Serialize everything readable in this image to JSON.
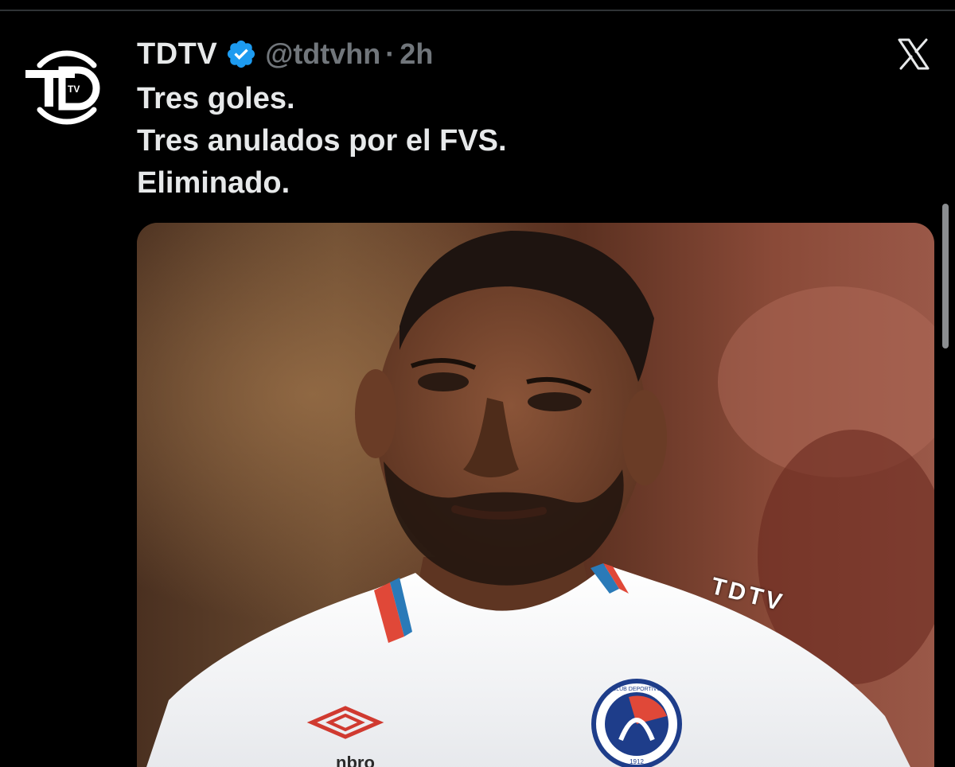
{
  "tweet": {
    "display_name": "TDTV",
    "handle": "@tdtvhn",
    "separator": "·",
    "time": "2h",
    "verified": true,
    "lines": [
      "Tres goles.",
      "Tres anulados por el FVS.",
      "Eliminado."
    ],
    "media": {
      "watermark": "TDTV",
      "kit_brand_partial": "nbro",
      "crest_text": "CLUB DEPORTIVO",
      "crest_year": "1912"
    }
  },
  "avatar": {
    "logo_text": "TV"
  },
  "icons": {
    "verified": "verified-badge-icon",
    "platform": "x-logo-icon"
  },
  "colors": {
    "background": "#000000",
    "text_primary": "#e7e9ea",
    "text_secondary": "#71767b",
    "verified_blue": "#1d9bf0"
  }
}
